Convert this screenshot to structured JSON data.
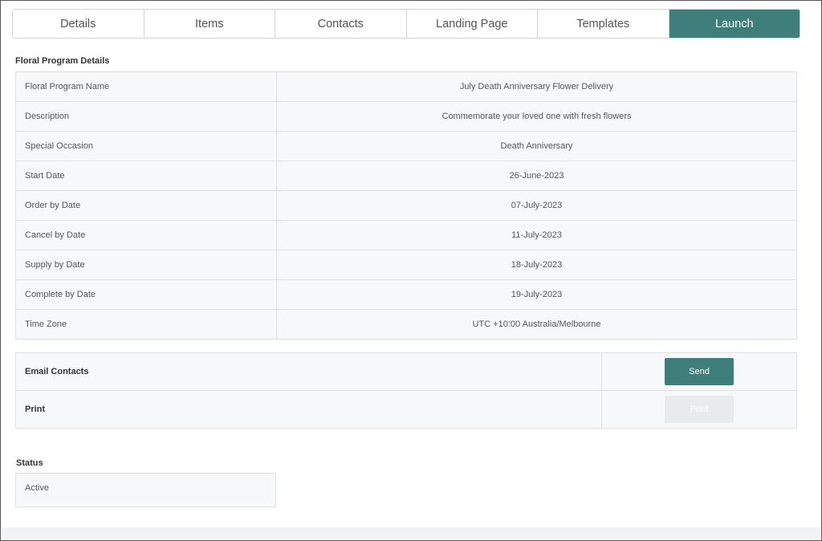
{
  "tabs": [
    {
      "label": "Details"
    },
    {
      "label": "Items"
    },
    {
      "label": "Contacts"
    },
    {
      "label": "Landing Page"
    },
    {
      "label": "Templates"
    },
    {
      "label": "Launch"
    }
  ],
  "active_tab": "Launch",
  "details": {
    "title": "Floral Program Details",
    "rows": [
      {
        "label": "Floral Program Name",
        "value": "July Death Anniversary Flower Delivery"
      },
      {
        "label": "Description",
        "value": "Commemorate your loved one with fresh flowers"
      },
      {
        "label": "Special Occasion",
        "value": "Death Anniversary"
      },
      {
        "label": "Start Date",
        "value": "26-June-2023"
      },
      {
        "label": "Order by Date",
        "value": "07-July-2023"
      },
      {
        "label": "Cancel by Date",
        "value": "11-July-2023"
      },
      {
        "label": "Supply by Date",
        "value": "18-July-2023"
      },
      {
        "label": "Complete by Date",
        "value": "19-July-2023"
      },
      {
        "label": "Time Zone",
        "value": "UTC +10:00 Australia/Melbourne"
      }
    ]
  },
  "actions": {
    "email": {
      "label": "Email Contacts",
      "button": "Send"
    },
    "print": {
      "label": "Print",
      "button": "Print"
    }
  },
  "status": {
    "title": "Status",
    "value": "Active"
  },
  "colors": {
    "accent": "#3e7f7b",
    "disabled_button": "#e9eaec"
  }
}
